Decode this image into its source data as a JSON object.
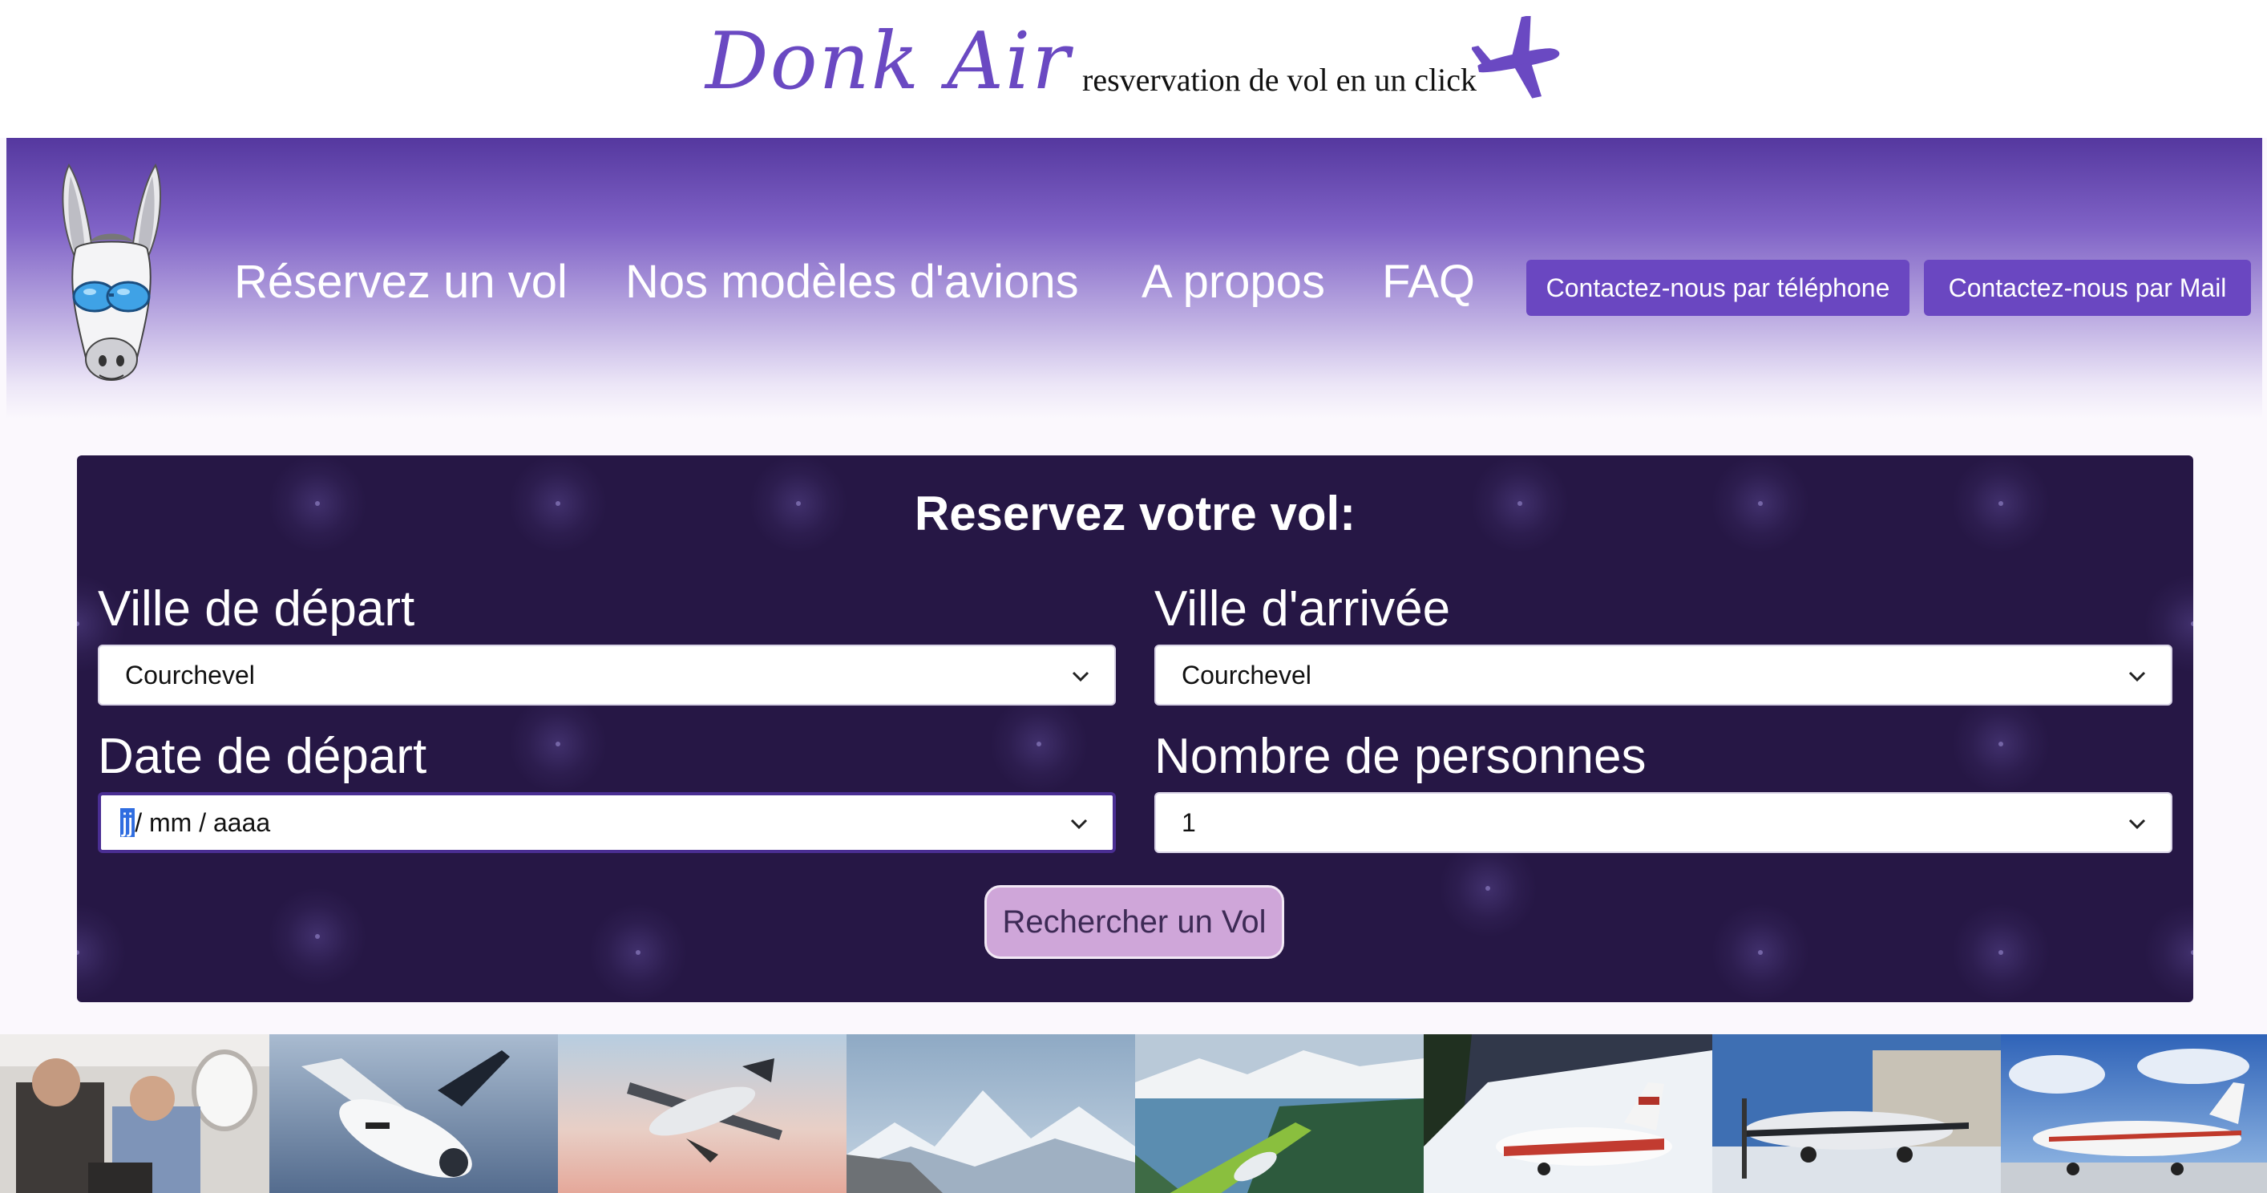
{
  "header": {
    "brand_name": "Donk Air",
    "tagline": "resvervation de vol en un click",
    "logo_icon": "airplane-icon",
    "brand_color": "#6a49c2"
  },
  "nav": {
    "mascot": "donkey-with-sunglasses",
    "links": [
      "Réservez un vol",
      "Nos modèles d'avions",
      "A propos",
      "FAQ"
    ],
    "contact_phone": "Contactez-nous par téléphone",
    "contact_mail": "Contactez-nous par Mail"
  },
  "booking": {
    "title": "Reservez votre vol:",
    "departure_city_label": "Ville de départ",
    "departure_city_value": "Courchevel",
    "arrival_city_label": "Ville d'arrivée",
    "arrival_city_value": "Courchevel",
    "departure_date_label": "Date de départ",
    "date_day": "jj",
    "date_rest": "/ mm / aaaa",
    "passengers_label": "Nombre de personnes",
    "passengers_value": "1",
    "search_button": "Rechercher un Vol"
  },
  "colors": {
    "nav_gradient_top": "#55389f",
    "panel_background": "#261745",
    "button_purple": "#6a47c1",
    "search_button_bg": "#cfa6d9"
  },
  "photo_strip": [
    "cabin-passengers-photo",
    "white-jet-flying-photo",
    "propeller-plane-sunset-photo",
    "mountain-jet-wing-photo",
    "plane-over-fjord-photo",
    "jet-on-snow-photo",
    "plane-by-hangar-photo",
    "plane-on-runway-photo"
  ]
}
